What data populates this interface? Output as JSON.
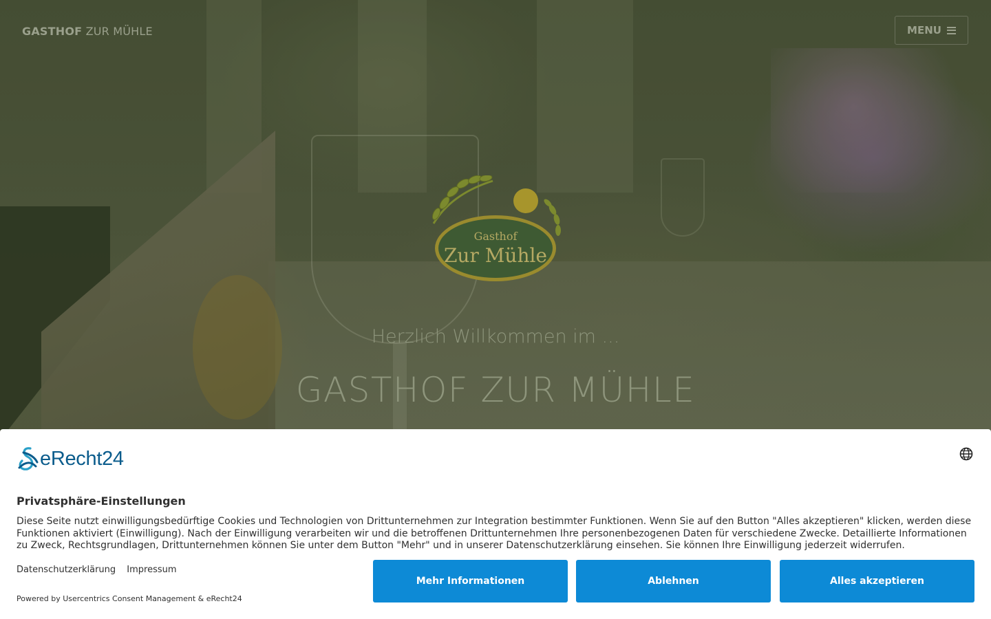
{
  "header": {
    "brand_bold": "GASTHOF",
    "brand_light": "ZUR MÜHLE",
    "menu_label": "MENU"
  },
  "hero": {
    "logo_top": "Gasthof",
    "logo_bottom": "Zur Mühle",
    "welcome": "Herzlich Willkommen im ...",
    "title": "GASTHOF ZUR MÜHLE"
  },
  "consent": {
    "brand": "eRecht24",
    "title": "Privatsphäre-Einstellungen",
    "text": "Diese Seite nutzt einwilligungsbedürftige Cookies und Technologien von Drittunternehmen zur Integration bestimmter Funktionen. Wenn Sie auf den Button \"Alles akzeptieren\" klicken, werden diese Funktionen aktiviert (Einwilligung). Nach der Einwilligung verarbeiten wir und die betroffenen Drittunternehmen Ihre personenbezogenen Daten für verschiedene Zwecke. Detaillierte Informationen zu Zweck, Rechtsgrundlagen, Drittunternehmen können Sie unter dem Button \"Mehr\" und in unserer Datenschutzerklärung einsehen. Sie können Ihre Einwilligung jederzeit widerrufen.",
    "link_privacy": "Datenschutzerklärung",
    "link_imprint": "Impressum",
    "powered": "Powered by Usercentrics Consent Management & eRecht24",
    "btn_more": "Mehr Informationen",
    "btn_deny": "Ablehnen",
    "btn_accept": "Alles akzeptieren"
  },
  "colors": {
    "accent": "#0d8ad6",
    "brand_blue": "#0b5c8c"
  }
}
